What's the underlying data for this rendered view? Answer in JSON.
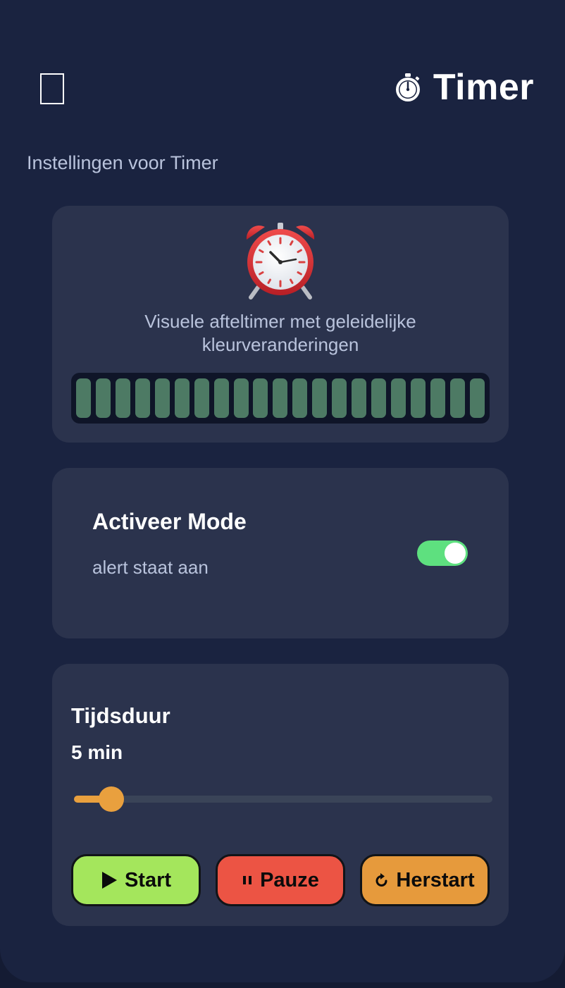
{
  "header": {
    "title": "Timer",
    "title_icon": "stopwatch-icon",
    "back_icon": "back-icon"
  },
  "subtitle": "Instellingen voor Timer",
  "visual_card": {
    "icon": "alarm-clock-icon",
    "description": "Visuele afteltimer met geleidelijke kleurveranderingen",
    "bar_count": 21,
    "bar_color": "#4d7a64"
  },
  "mode_card": {
    "title": "Activeer Mode",
    "status": "alert staat aan",
    "toggle_on": true,
    "toggle_color": "#5ee07f"
  },
  "duration_card": {
    "label": "Tijdsduur",
    "value": "5 min",
    "slider_fraction": 0.09,
    "accent_color": "#e9a03e",
    "buttons": {
      "start": "Start",
      "pause": "Pauze",
      "restart": "Herstart"
    },
    "button_colors": {
      "start": "#a4e65c",
      "pause": "#ec5444",
      "restart": "#e69a3c"
    }
  }
}
